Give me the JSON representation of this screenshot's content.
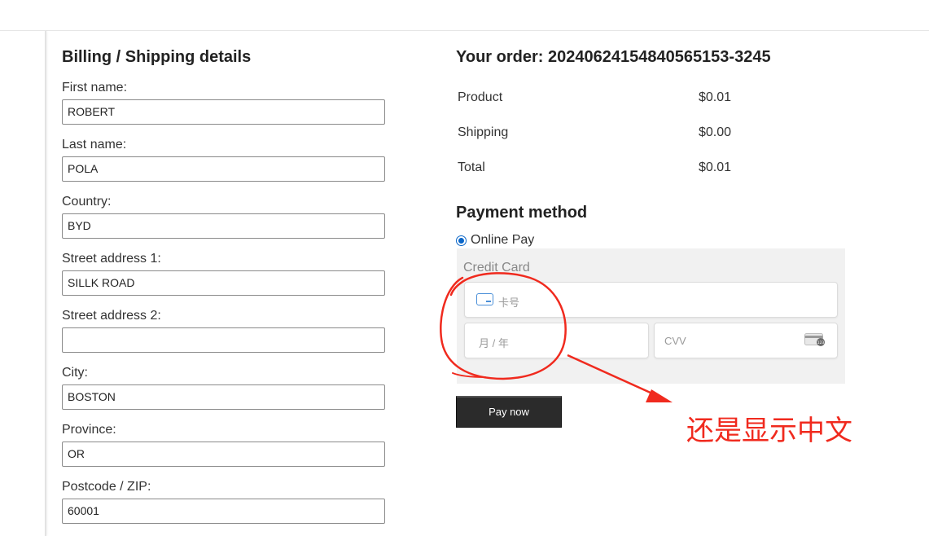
{
  "billing": {
    "title": "Billing / Shipping details",
    "fields": [
      {
        "label": "First name:",
        "value": "ROBERT"
      },
      {
        "label": "Last name:",
        "value": "POLA"
      },
      {
        "label": "Country:",
        "value": "BYD"
      },
      {
        "label": "Street address 1:",
        "value": "SILLK ROAD"
      },
      {
        "label": "Street address 2:",
        "value": ""
      },
      {
        "label": "City:",
        "value": "BOSTON"
      },
      {
        "label": "Province:",
        "value": "OR"
      },
      {
        "label": "Postcode / ZIP:",
        "value": "60001"
      }
    ]
  },
  "order": {
    "title": "Your order:  20240624154840565153-3245",
    "rows": [
      {
        "label": "Product",
        "value": "$0.01"
      },
      {
        "label": "Shipping",
        "value": "$0.00"
      },
      {
        "label": "Total",
        "value": "$0.01"
      }
    ]
  },
  "payment": {
    "title": "Payment method",
    "option_label": "Online Pay",
    "card_title": "Credit Card",
    "card_number_placeholder": "卡号",
    "expiry_placeholder": "月 / 年",
    "cvv_placeholder": "CVV",
    "pay_button": "Pay now"
  },
  "annotation": {
    "text": "还是显示中文",
    "color": "#f02a1e"
  },
  "icons": {
    "card": "credit-card-icon",
    "cvv": "cvv-card-icon"
  }
}
